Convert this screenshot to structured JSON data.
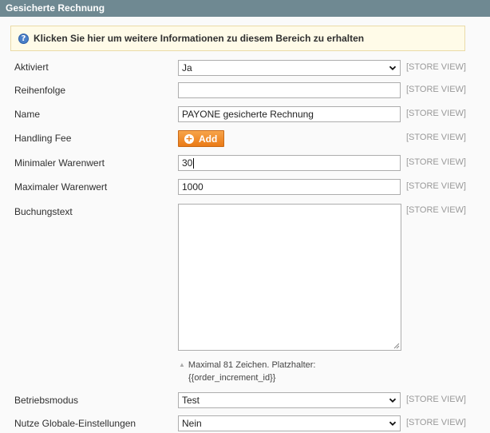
{
  "section": {
    "title": "Gesicherte Rechnung"
  },
  "info": {
    "text": "Klicken Sie hier um weitere Informationen zu diesem Bereich zu erhalten",
    "icon": "help-icon"
  },
  "scope_label": "[STORE VIEW]",
  "fields": {
    "aktiviert": {
      "label": "Aktiviert",
      "value": "Ja"
    },
    "reihenfolge": {
      "label": "Reihenfolge",
      "value": ""
    },
    "name": {
      "label": "Name",
      "value": "PAYONE gesicherte Rechnung"
    },
    "handling_fee": {
      "label": "Handling Fee",
      "button": "Add"
    },
    "min_warenwert": {
      "label": "Minimaler Warenwert",
      "value": "30"
    },
    "max_warenwert": {
      "label": "Maximaler Warenwert",
      "value": "1000"
    },
    "buchungstext": {
      "label": "Buchungstext",
      "value": "",
      "note_line1": "Maximal 81 Zeichen. Platzhalter:",
      "note_line2": "{{order_increment_id}}"
    },
    "betriebsmodus": {
      "label": "Betriebsmodus",
      "value": "Test"
    },
    "globale": {
      "label": "Nutze Globale-Einstellungen",
      "value": "Nein"
    }
  },
  "colors": {
    "header": "#6f8992",
    "accent_button": "#ea7a16",
    "info_background": "#fffbe8"
  }
}
